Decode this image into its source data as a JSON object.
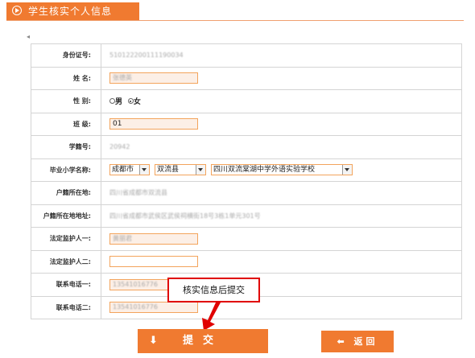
{
  "header": {
    "title": "学生核实个人信息",
    "icon": "play-circle-icon"
  },
  "nav": {
    "left_arrow": "◂"
  },
  "form": {
    "id_card": {
      "label": "身份证号:",
      "value": "510122200111190034"
    },
    "name": {
      "label": "姓 名:",
      "value": "张德英"
    },
    "gender": {
      "label": "性 别:",
      "options": [
        "男",
        "女"
      ],
      "selected": "女"
    },
    "class": {
      "label": "班 级:",
      "value": "01"
    },
    "student_no": {
      "label": "学籍号:",
      "value": "20942"
    },
    "primary_school": {
      "label": "毕业小学名称:",
      "city": "成都市",
      "county": "双流县",
      "school": "四川双流棠湖中学外语实验学校"
    },
    "hukou_place": {
      "label": "户籍所在地:",
      "value": "四川省成都市双流县"
    },
    "hukou_address": {
      "label": "户籍所在地地址:",
      "value": "四川省成都市武侯区武侯祠横街18号3栋1单元301号"
    },
    "guardian1": {
      "label": "法定监护人一:",
      "value": "黄丽君"
    },
    "guardian2": {
      "label": "法定监护人二:",
      "value": ""
    },
    "phone1": {
      "label": "联系电话一:",
      "value": "13541016776"
    },
    "phone2": {
      "label": "联系电话二:",
      "value": "13541016776"
    }
  },
  "buttons": {
    "submit": "提交",
    "submit_icon": "⬇",
    "back": "返回",
    "back_icon": "⬅"
  },
  "tooltip": {
    "text": "核实信息后提交"
  },
  "colors": {
    "accent": "#f07a30",
    "highlight": "#e00000"
  }
}
